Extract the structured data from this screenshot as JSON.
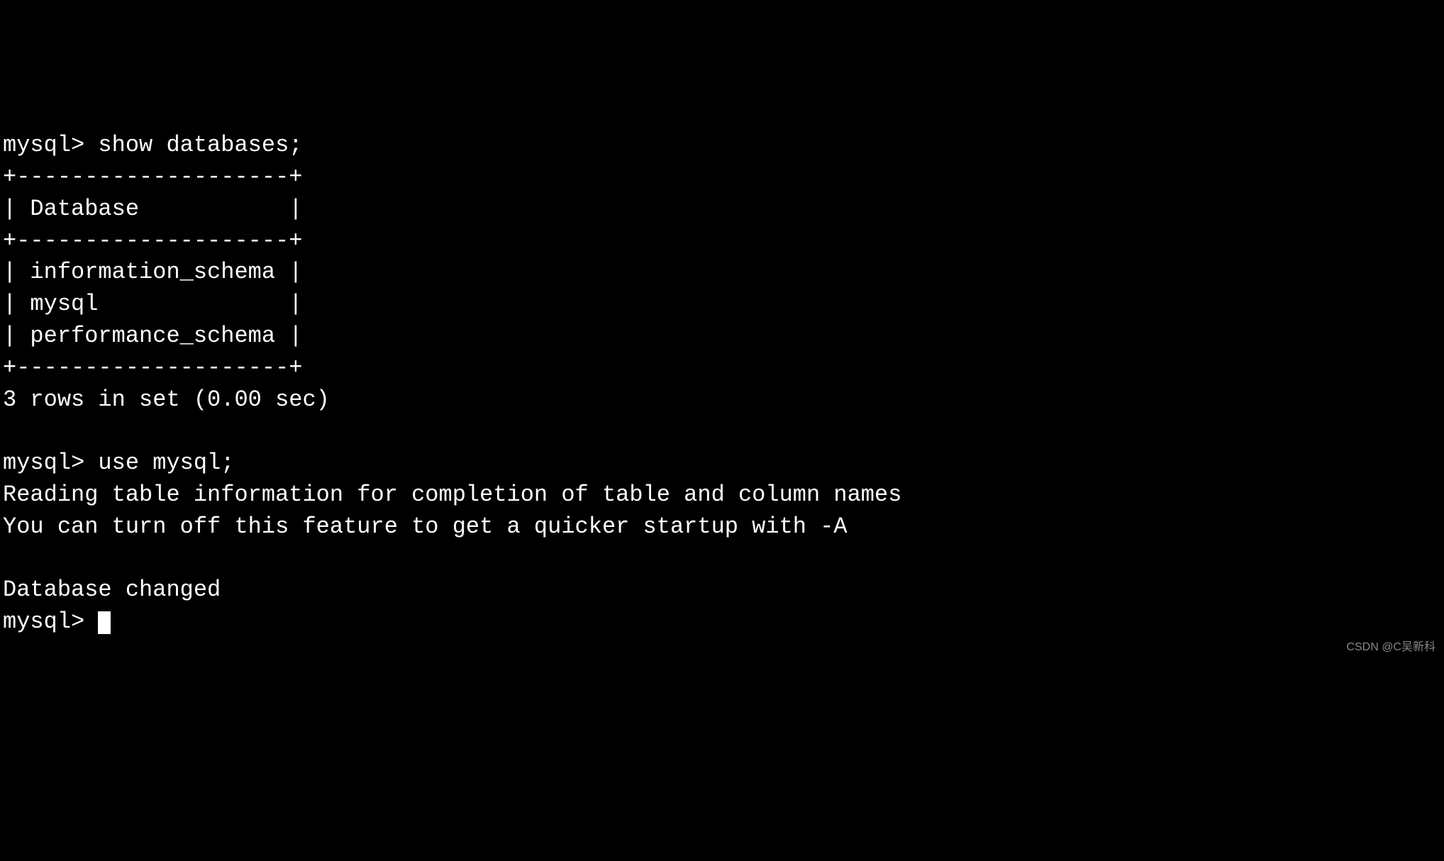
{
  "terminal": {
    "prompt": "mysql> ",
    "command1": "show databases;",
    "table": {
      "borderTop": "+--------------------+",
      "headerRow": "| Database           |",
      "borderMid": "+--------------------+",
      "rows": [
        "| information_schema |",
        "| mysql              |",
        "| performance_schema |"
      ],
      "borderBottom": "+--------------------+"
    },
    "resultSummary": "3 rows in set (0.00 sec)",
    "blank1": "",
    "command2": "use mysql;",
    "readingInfo": "Reading table information for completion of table and column names",
    "turnOffInfo": "You can turn off this feature to get a quicker startup with -A",
    "blank2": "",
    "dbChanged": "Database changed"
  },
  "watermark": "CSDN @C吴新科"
}
